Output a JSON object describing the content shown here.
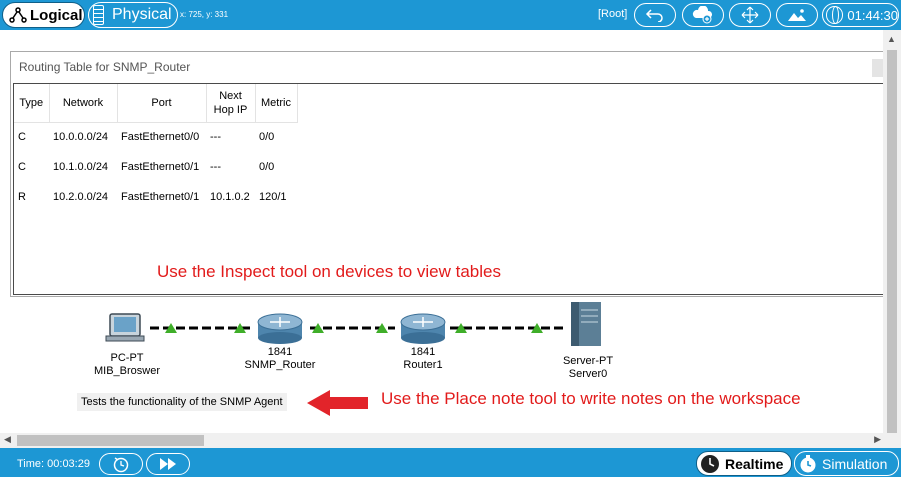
{
  "topbar": {
    "logical_label": "Logical",
    "physical_label": "Physical",
    "coords": "x: 725, y: 331",
    "root_label": "[Root]",
    "clock": "01:44:30",
    "icons": [
      "back-icon",
      "cluster-icon",
      "move-icon",
      "background-image-icon",
      "viewport-icon"
    ]
  },
  "routing_window": {
    "title": "Routing Table for SNMP_Router",
    "headers": [
      "Type",
      "Network",
      "Port",
      "Next Hop IP",
      "Metric"
    ],
    "header_nexthop_line1": "Next",
    "header_nexthop_line2": "Hop IP",
    "rows": [
      [
        "C",
        "10.0.0.0/24",
        "FastEthernet0/0",
        "---",
        "0/0"
      ],
      [
        "C",
        "10.1.0.0/24",
        "FastEthernet0/1",
        "---",
        "0/0"
      ],
      [
        "R",
        "10.2.0.0/24",
        "FastEthernet0/1",
        "10.1.0.2",
        "120/1"
      ]
    ],
    "inspect_note": "Use the Inspect tool on devices to view tables"
  },
  "topology": {
    "devices": [
      {
        "model": "PC-PT",
        "name": "MIB_Broswer"
      },
      {
        "model": "1841",
        "name": "SNMP_Router"
      },
      {
        "model": "1841",
        "name": "Router1"
      },
      {
        "model": "Server-PT",
        "name": "Server0"
      }
    ],
    "sticky_note": "Tests the functionality of the SNMP Agent",
    "place_note": "Use the Place note tool to write notes on the workspace",
    "colors": {
      "annotation": "#e21b1b",
      "link_up": "#3fae29",
      "router": "#5b8fb5"
    }
  },
  "bottombar": {
    "time_label": "Time: 00:03:29",
    "realtime_label": "Realtime",
    "simulation_label": "Simulation"
  },
  "theme": {
    "bar_color": "#1d97d4"
  }
}
